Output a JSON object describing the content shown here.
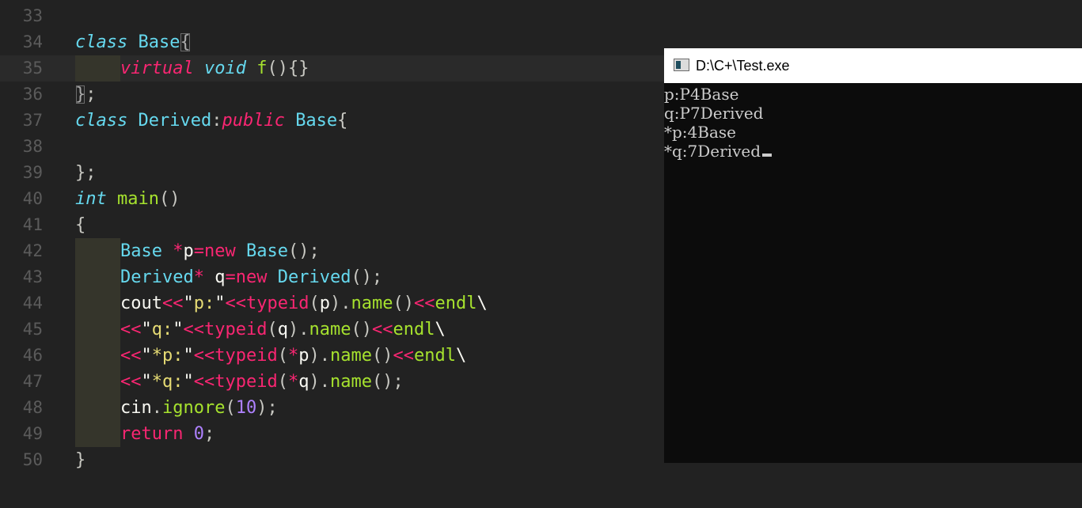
{
  "editor": {
    "line_numbers": [
      "33",
      "34",
      "35",
      "36",
      "37",
      "38",
      "39",
      "40",
      "41",
      "42",
      "43",
      "44",
      "45",
      "46",
      "47",
      "48",
      "49",
      "50"
    ],
    "lines": [
      [],
      [
        {
          "t": "class",
          "c": "kw"
        },
        {
          "t": " ",
          "c": "pl"
        },
        {
          "t": "Base",
          "c": "ty"
        },
        {
          "t": "{",
          "c": "br"
        }
      ],
      [
        {
          "t": "virtual",
          "c": "st"
        },
        {
          "t": " ",
          "c": "pl"
        },
        {
          "t": "void",
          "c": "kw"
        },
        {
          "t": " ",
          "c": "pl"
        },
        {
          "t": "f",
          "c": "fn"
        },
        {
          "t": "()",
          "c": "pun"
        },
        {
          "t": "{}",
          "c": "pun"
        }
      ],
      [
        {
          "t": "}",
          "c": "br"
        },
        {
          "t": ";",
          "c": "pun"
        }
      ],
      [
        {
          "t": "class",
          "c": "kw"
        },
        {
          "t": " ",
          "c": "pl"
        },
        {
          "t": "Derived",
          "c": "ty"
        },
        {
          "t": ":",
          "c": "pun"
        },
        {
          "t": "public",
          "c": "st"
        },
        {
          "t": " ",
          "c": "pl"
        },
        {
          "t": "Base",
          "c": "ty"
        },
        {
          "t": "{",
          "c": "pun"
        }
      ],
      [],
      [
        {
          "t": "};",
          "c": "pun"
        }
      ],
      [
        {
          "t": "int",
          "c": "kw"
        },
        {
          "t": " ",
          "c": "pl"
        },
        {
          "t": "main",
          "c": "fn"
        },
        {
          "t": "()",
          "c": "pun"
        }
      ],
      [
        {
          "t": "{",
          "c": "pun"
        }
      ],
      [
        {
          "t": "Base",
          "c": "ty"
        },
        {
          "t": " ",
          "c": "pl"
        },
        {
          "t": "*",
          "c": "op"
        },
        {
          "t": "p",
          "c": "pl"
        },
        {
          "t": "=",
          "c": "op"
        },
        {
          "t": "new",
          "c": "op"
        },
        {
          "t": " ",
          "c": "pl"
        },
        {
          "t": "Base",
          "c": "ty"
        },
        {
          "t": "();",
          "c": "pun"
        }
      ],
      [
        {
          "t": "Derived",
          "c": "ty"
        },
        {
          "t": "*",
          "c": "op"
        },
        {
          "t": " q",
          "c": "pl"
        },
        {
          "t": "=",
          "c": "op"
        },
        {
          "t": "new",
          "c": "op"
        },
        {
          "t": " ",
          "c": "pl"
        },
        {
          "t": "Derived",
          "c": "ty"
        },
        {
          "t": "();",
          "c": "pun"
        }
      ],
      [
        {
          "t": "cout",
          "c": "pl"
        },
        {
          "t": "<<",
          "c": "op"
        },
        {
          "t": "\"",
          "c": "pl"
        },
        {
          "t": "p:",
          "c": "str"
        },
        {
          "t": "\"",
          "c": "pl"
        },
        {
          "t": "<<",
          "c": "op"
        },
        {
          "t": "typeid",
          "c": "op"
        },
        {
          "t": "(",
          "c": "pun"
        },
        {
          "t": "p",
          "c": "pl"
        },
        {
          "t": ").",
          "c": "pun"
        },
        {
          "t": "name",
          "c": "fn"
        },
        {
          "t": "()",
          "c": "pun"
        },
        {
          "t": "<<",
          "c": "op"
        },
        {
          "t": "endl",
          "c": "fn"
        },
        {
          "t": "\\",
          "c": "pl"
        }
      ],
      [
        {
          "t": "<<",
          "c": "op"
        },
        {
          "t": "\"",
          "c": "pl"
        },
        {
          "t": "q:",
          "c": "str"
        },
        {
          "t": "\"",
          "c": "pl"
        },
        {
          "t": "<<",
          "c": "op"
        },
        {
          "t": "typeid",
          "c": "op"
        },
        {
          "t": "(",
          "c": "pun"
        },
        {
          "t": "q",
          "c": "pl"
        },
        {
          "t": ").",
          "c": "pun"
        },
        {
          "t": "name",
          "c": "fn"
        },
        {
          "t": "()",
          "c": "pun"
        },
        {
          "t": "<<",
          "c": "op"
        },
        {
          "t": "endl",
          "c": "fn"
        },
        {
          "t": "\\",
          "c": "pl"
        }
      ],
      [
        {
          "t": "<<",
          "c": "op"
        },
        {
          "t": "\"",
          "c": "pl"
        },
        {
          "t": "*p:",
          "c": "str"
        },
        {
          "t": "\"",
          "c": "pl"
        },
        {
          "t": "<<",
          "c": "op"
        },
        {
          "t": "typeid",
          "c": "op"
        },
        {
          "t": "(",
          "c": "pun"
        },
        {
          "t": "*",
          "c": "op"
        },
        {
          "t": "p",
          "c": "pl"
        },
        {
          "t": ").",
          "c": "pun"
        },
        {
          "t": "name",
          "c": "fn"
        },
        {
          "t": "()",
          "c": "pun"
        },
        {
          "t": "<<",
          "c": "op"
        },
        {
          "t": "endl",
          "c": "fn"
        },
        {
          "t": "\\",
          "c": "pl"
        }
      ],
      [
        {
          "t": "<<",
          "c": "op"
        },
        {
          "t": "\"",
          "c": "pl"
        },
        {
          "t": "*q:",
          "c": "str"
        },
        {
          "t": "\"",
          "c": "pl"
        },
        {
          "t": "<<",
          "c": "op"
        },
        {
          "t": "typeid",
          "c": "op"
        },
        {
          "t": "(",
          "c": "pun"
        },
        {
          "t": "*",
          "c": "op"
        },
        {
          "t": "q",
          "c": "pl"
        },
        {
          "t": ").",
          "c": "pun"
        },
        {
          "t": "name",
          "c": "fn"
        },
        {
          "t": "();",
          "c": "pun"
        }
      ],
      [
        {
          "t": "cin",
          "c": "pl"
        },
        {
          "t": ".",
          "c": "pun"
        },
        {
          "t": "ignore",
          "c": "fn"
        },
        {
          "t": "(",
          "c": "pun"
        },
        {
          "t": "10",
          "c": "num"
        },
        {
          "t": ");",
          "c": "pun"
        }
      ],
      [
        {
          "t": "return",
          "c": "op"
        },
        {
          "t": " ",
          "c": "pl"
        },
        {
          "t": "0",
          "c": "num"
        },
        {
          "t": ";",
          "c": "pun"
        }
      ],
      [
        {
          "t": "}",
          "c": "pun"
        }
      ]
    ]
  },
  "console": {
    "title": "D:\\C+\\Test.exe",
    "lines": [
      "p:P4Base",
      "q:P7Derived",
      "*p:4Base",
      "*q:7Derived"
    ]
  },
  "colors": {
    "editor_bg": "#222222",
    "keyword": "#66d9ef",
    "storage": "#f92672",
    "function": "#a6e22e",
    "string": "#e6db74",
    "number": "#ae81ff",
    "console_bg": "#0c0c0c",
    "console_text": "#cccccc"
  },
  "icons": {
    "console_app": "console-window-icon"
  }
}
